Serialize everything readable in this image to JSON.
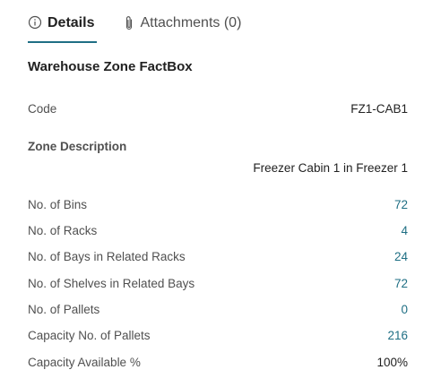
{
  "tabs": {
    "details": {
      "label": "Details",
      "icon": "info-icon",
      "active": true
    },
    "attachments": {
      "label": "Attachments (0)",
      "icon": "paperclip-icon"
    }
  },
  "factbox": {
    "title": "Warehouse Zone FactBox",
    "code_label": "Code",
    "code_value": "FZ1-CAB1",
    "zone_description_label": "Zone Description",
    "zone_description_value": "Freezer Cabin 1 in Freezer 1",
    "stats": [
      {
        "label": "No. of Bins",
        "value": "72",
        "link": true
      },
      {
        "label": "No. of Racks",
        "value": "4",
        "link": true
      },
      {
        "label": "No. of Bays in Related Racks",
        "value": "24",
        "link": true
      },
      {
        "label": "No. of Shelves in Related Bays",
        "value": "72",
        "link": true
      },
      {
        "label": "No. of Pallets",
        "value": "0",
        "link": true
      },
      {
        "label": "Capacity No. of Pallets",
        "value": "216",
        "link": true
      },
      {
        "label": "Capacity Available %",
        "value": "100%",
        "link": false
      }
    ]
  },
  "colors": {
    "accent": "#1f6f84",
    "label_text": "#505050",
    "value_text": "#212121"
  }
}
